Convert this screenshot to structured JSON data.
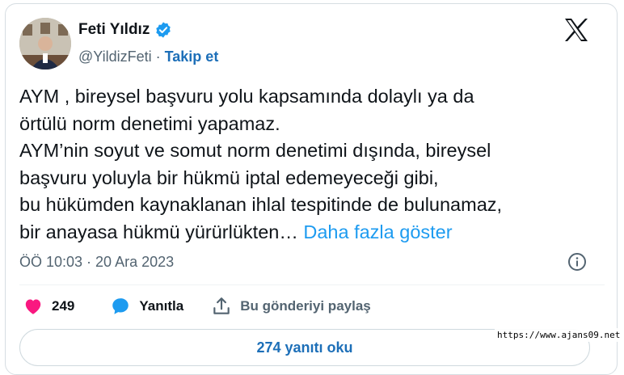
{
  "author": {
    "name": "Feti Yıldız",
    "handle": "@YildizFeti",
    "separator": "·",
    "follow_label": "Takip et"
  },
  "tweet": {
    "text": "AYM , bireysel başvuru yolu kapsamında dolaylı ya da\nörtülü norm denetimi yapamaz.\nAYM’nin soyut ve somut norm denetimi dışında, bireysel\nbaşvuru yoluyla bir hükmü iptal edemeyeceği gibi,\nbu hükümden kaynaklanan ihlal tespitinde de bulunamaz,\n bir anayasa hükmü yürürlükten…",
    "show_more_label": "Daha fazla göster",
    "timestamp": "ÖÖ 10:03 · 20 Ara 2023"
  },
  "actions": {
    "likes_count": "249",
    "reply_label": "Yanıtla",
    "share_label": "Bu gönderiyi paylaş"
  },
  "replies_button_label": "274 yanıtı oku",
  "watermark": "https://www.ajans09.net",
  "colors": {
    "accent": "#1d9bf0",
    "link_dark": "#1d6fb8",
    "like": "#f91880",
    "secondary_text": "#536471"
  },
  "icons": [
    "verified-badge-icon",
    "x-logo-icon",
    "info-icon",
    "heart-icon",
    "reply-bubble-icon",
    "share-icon"
  ]
}
